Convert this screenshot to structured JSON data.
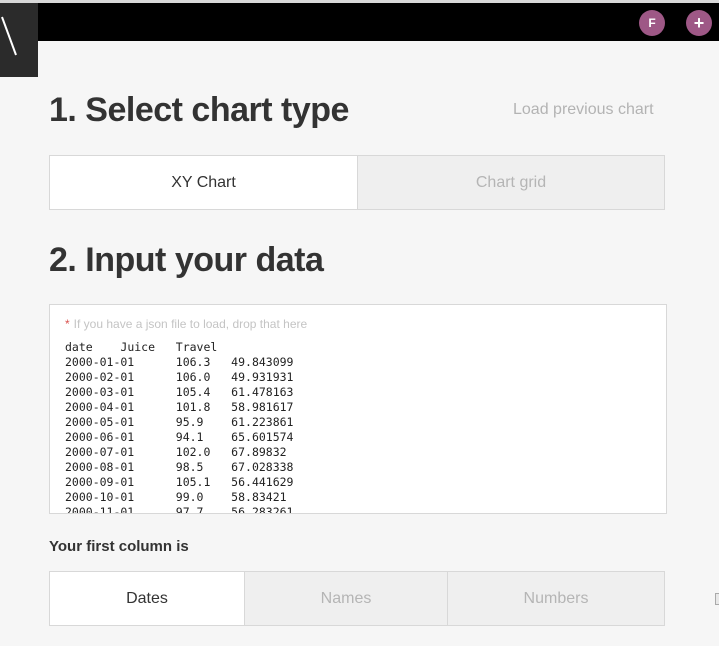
{
  "header": {
    "user_initial": "F",
    "add_symbol": "+"
  },
  "step1": {
    "title": "1. Select chart type",
    "load_previous": "Load previous chart",
    "options": [
      "XY Chart",
      "Chart grid"
    ],
    "active": "XY Chart"
  },
  "step2": {
    "title": "2. Input your data",
    "drop_hint": "If you have a json file to load, drop that here",
    "data_text": "date\tJuice\tTravel\n2000-01-01\t106.3\t49.843099\n2000-02-01\t106.0\t49.931931\n2000-03-01\t105.4\t61.478163\n2000-04-01\t101.8\t58.981617\n2000-05-01\t95.9\t61.223861\n2000-06-01\t94.1\t65.601574\n2000-07-01\t102.0\t67.89832\n2000-08-01\t98.5\t67.028338\n2000-09-01\t105.1\t56.441629\n2000-10-01\t99.0\t58.83421\n2000-11-01\t97.7\t56.283261"
  },
  "first_column": {
    "label": "Your first column is",
    "options": [
      "Dates",
      "Names",
      "Numbers"
    ],
    "active": "Dates"
  },
  "colors": {
    "topbar": "#000000",
    "avatar": "#9e5886",
    "page_bg": "#f6f6f6"
  }
}
